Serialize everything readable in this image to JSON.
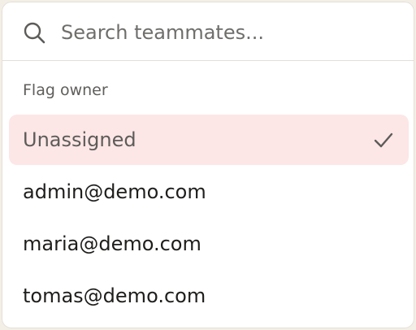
{
  "search": {
    "placeholder": "Search teammates...",
    "value": ""
  },
  "group": {
    "label": "Flag owner"
  },
  "options": [
    {
      "label": "Unassigned",
      "selected": true
    },
    {
      "label": "admin@demo.com",
      "selected": false
    },
    {
      "label": "maria@demo.com",
      "selected": false
    },
    {
      "label": "tomas@demo.com",
      "selected": false
    }
  ],
  "icons": {
    "search": "search-icon",
    "check": "check-icon"
  },
  "colors": {
    "selected_bg": "#fde6e6",
    "border": "#e6e1d8"
  }
}
